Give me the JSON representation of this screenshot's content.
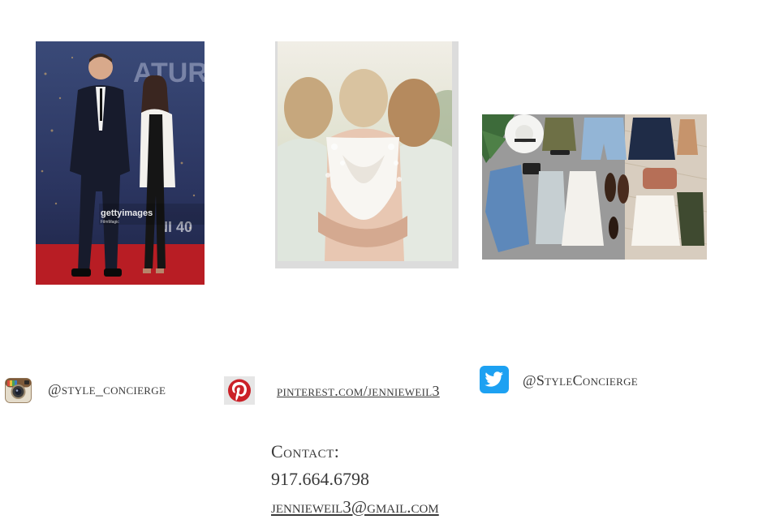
{
  "photos": {
    "red_carpet": {
      "watermark": "gettyimages",
      "watermark_sub": "FilmMagic"
    },
    "bridesmaids": {},
    "flat_lay": {}
  },
  "social": {
    "instagram": {
      "icon": "instagram-icon",
      "handle": "@style_concierge"
    },
    "pinterest": {
      "icon": "pinterest-icon",
      "link": "pinterest.com/jennieweil3",
      "color": "#cb2027"
    },
    "twitter": {
      "icon": "twitter-icon",
      "handle": "@StyleConcierge",
      "color": "#1da1f2"
    }
  },
  "contact": {
    "heading": "Contact:",
    "phone": "917.664.6798",
    "email": "jennieweil3@gmail.com"
  }
}
